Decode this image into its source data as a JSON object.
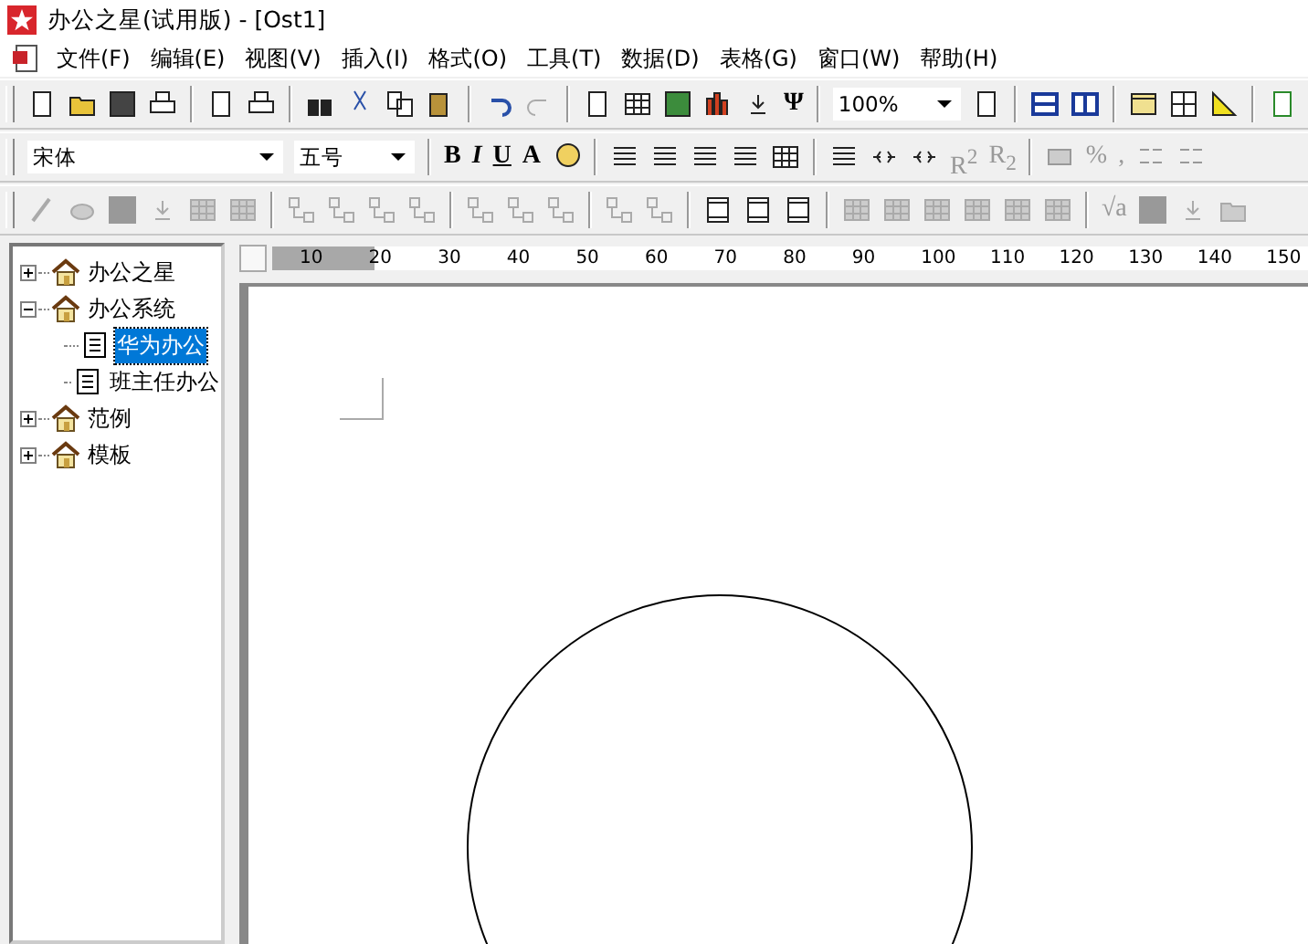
{
  "window": {
    "title": "办公之星(试用版) - [Ost1]"
  },
  "menu": [
    "文件(F)",
    "编辑(E)",
    "视图(V)",
    "插入(I)",
    "格式(O)",
    "工具(T)",
    "数据(D)",
    "表格(G)",
    "窗口(W)",
    "帮助(H)"
  ],
  "toolbar_texts": [
    {
      "text": "Ψ",
      "disabled": false
    },
    {
      "text": "B",
      "disabled": false
    },
    {
      "text": "I",
      "disabled": false
    },
    {
      "text": "U",
      "disabled": false
    },
    {
      "text": "A",
      "disabled": false
    },
    {
      "text": "R$^{2}$",
      "disabled": true
    },
    {
      "text": "R$_{2}$",
      "disabled": true
    },
    {
      "text": "%",
      "disabled": true
    },
    {
      "text": ",",
      "disabled": true
    },
    {
      "text": "√a",
      "disabled": true
    }
  ],
  "zoom": {
    "value": "100%"
  },
  "font": {
    "value": "宋体"
  },
  "font_size": {
    "value": "五号"
  },
  "tree": [
    {
      "label": "办公之星",
      "expanded": false,
      "selected": false
    },
    {
      "label": "办公系统",
      "expanded": true,
      "selected": false,
      "children": [
        {
          "label": "华为办公",
          "selected": true
        },
        {
          "label": "班主任办公",
          "selected": false
        }
      ]
    },
    {
      "label": "范例",
      "expanded": false,
      "selected": false
    },
    {
      "label": "模板",
      "expanded": false,
      "selected": false
    }
  ],
  "ruler": [
    "10",
    "20",
    "30",
    "40",
    "50",
    "60",
    "70",
    "80",
    "90",
    "100",
    "110",
    "120",
    "130",
    "140",
    "150"
  ]
}
